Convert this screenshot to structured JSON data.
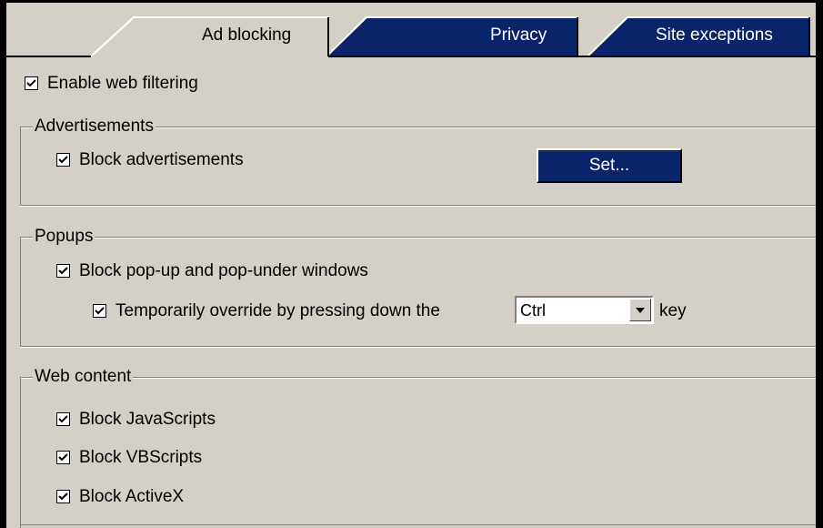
{
  "tabs": [
    {
      "label": "Ad blocking",
      "active": true
    },
    {
      "label": "Privacy",
      "active": false
    },
    {
      "label": "Site exceptions",
      "active": false
    }
  ],
  "enable_filtering": {
    "label": "Enable web filtering",
    "checked": true
  },
  "advertisements": {
    "legend": "Advertisements",
    "block": {
      "label": "Block advertisements",
      "checked": true
    },
    "set_button": "Set..."
  },
  "popups": {
    "legend": "Popups",
    "block": {
      "label": "Block pop-up and pop-under windows",
      "checked": true
    },
    "override": {
      "label": "Temporarily override by pressing down the",
      "checked": true
    },
    "key_select": "Ctrl",
    "key_suffix": "key"
  },
  "web_content": {
    "legend": "Web content",
    "javascripts": {
      "label": "Block JavaScripts",
      "checked": true
    },
    "vbscripts": {
      "label": "Block VBScripts",
      "checked": true
    },
    "activex": {
      "label": "Block ActiveX",
      "checked": true
    }
  },
  "colors": {
    "panel": "#d4d0c8",
    "inactive_tab": "#0a246a",
    "frame": "#000000"
  }
}
